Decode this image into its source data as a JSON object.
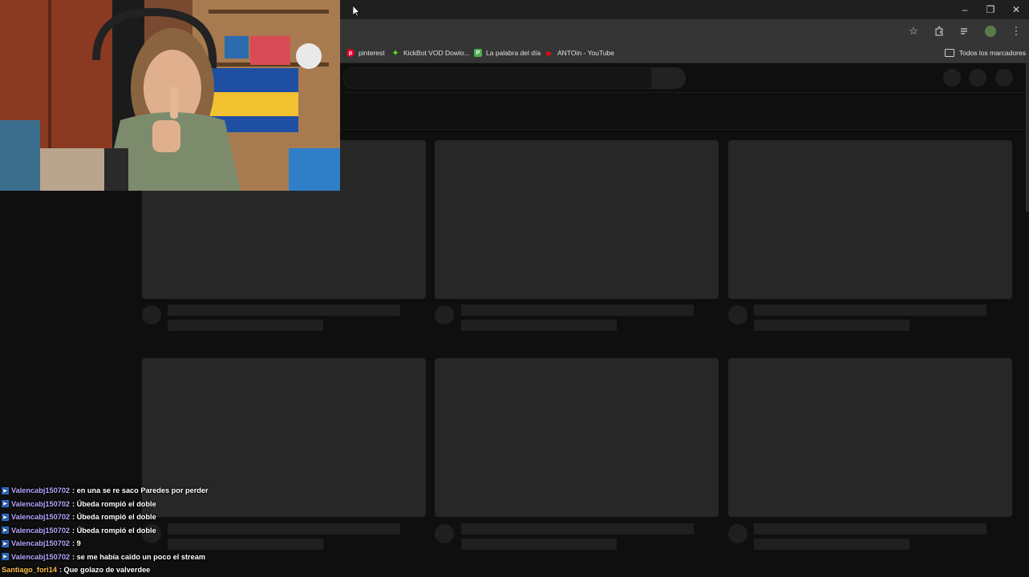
{
  "bookmarks": {
    "items": [
      {
        "label": "pinterest",
        "icon": "pinterest-icon",
        "color": "#e60023"
      },
      {
        "label": "KickBot VOD Dowlo...",
        "icon": "kickbot-icon",
        "color": "#53fc18"
      },
      {
        "label": "La palabra del día",
        "icon": "p-icon",
        "color": "#4caf50"
      },
      {
        "label": "ANTOin - YouTube",
        "icon": "youtube-icon",
        "color": "#ff0000"
      }
    ],
    "all_label": "Todos los marcadores"
  },
  "icons": {
    "star": "☆",
    "extensions": "puzzle-icon",
    "menu": "⋮"
  },
  "chat": {
    "messages": [
      {
        "user": "Valencabj150702",
        "user_color": "#b9a5ff",
        "text": ": en una se re saco Paredes por perder"
      },
      {
        "user": "Valencabj150702",
        "user_color": "#b9a5ff",
        "text": ": Úbeda rompió el doble"
      },
      {
        "user": "Valencabj150702",
        "user_color": "#b9a5ff",
        "text": ": Úbeda rompió el doble"
      },
      {
        "user": "Valencabj150702",
        "user_color": "#b9a5ff",
        "text": ": Úbeda rompió el doble"
      },
      {
        "user": "Valencabj150702",
        "user_color": "#b9a5ff",
        "text": ": 9"
      },
      {
        "user": "Valencabj150702",
        "user_color": "#b9a5ff",
        "text": ": se me había caído un poco el stream"
      },
      {
        "user": "Santiago_fori14",
        "user_color": "#ffbf47",
        "text": ": Que golazo de valverdee"
      }
    ]
  }
}
